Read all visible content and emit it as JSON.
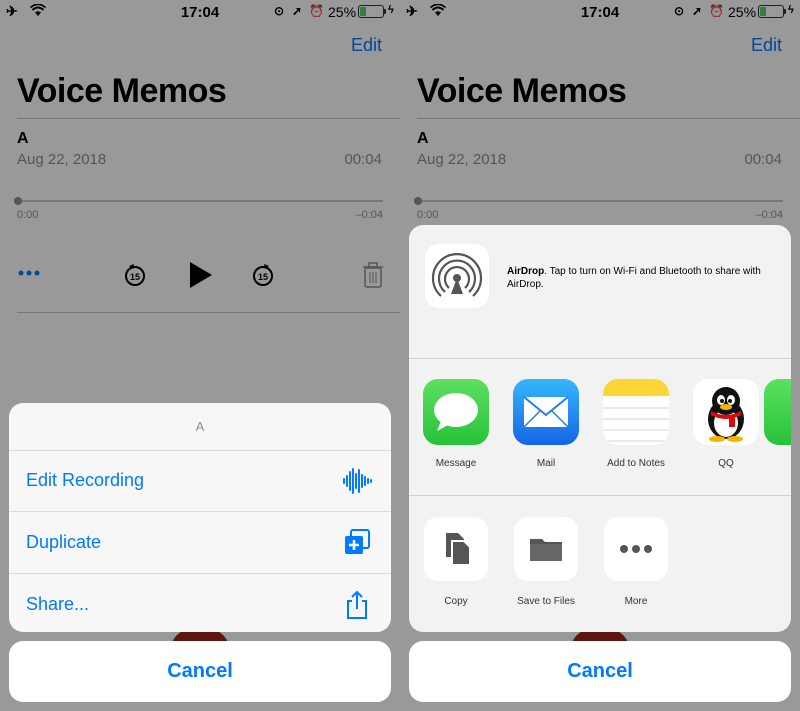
{
  "status": {
    "time": "17:04",
    "battery_pct": "25%"
  },
  "app": {
    "edit_label": "Edit",
    "title": "Voice Memos",
    "memo": {
      "name": "A",
      "date": "Aug 22, 2018",
      "duration": "00:04"
    },
    "scrubber": {
      "start": "0:00",
      "end": "–0:04"
    }
  },
  "action_sheet": {
    "header": "A",
    "items": [
      {
        "label": "Edit Recording",
        "icon": "waveform-icon"
      },
      {
        "label": "Duplicate",
        "icon": "duplicate-icon"
      },
      {
        "label": "Share...",
        "icon": "share-icon"
      }
    ],
    "cancel": "Cancel"
  },
  "share_sheet": {
    "airdrop_title": "AirDrop",
    "airdrop_text": ". Tap to turn on Wi-Fi and Bluetooth to share with AirDrop.",
    "apps": [
      {
        "label": "Message",
        "icon": "messages-icon"
      },
      {
        "label": "Mail",
        "icon": "mail-icon"
      },
      {
        "label": "Add to Notes",
        "icon": "notes-icon"
      },
      {
        "label": "QQ",
        "icon": "qq-icon"
      }
    ],
    "actions": [
      {
        "label": "Copy",
        "icon": "copy-icon"
      },
      {
        "label": "Save to Files",
        "icon": "folder-icon"
      },
      {
        "label": "More",
        "icon": "more-icon"
      }
    ],
    "cancel": "Cancel"
  },
  "colors": {
    "accent": "#007aff",
    "battery": "#4cd964"
  }
}
